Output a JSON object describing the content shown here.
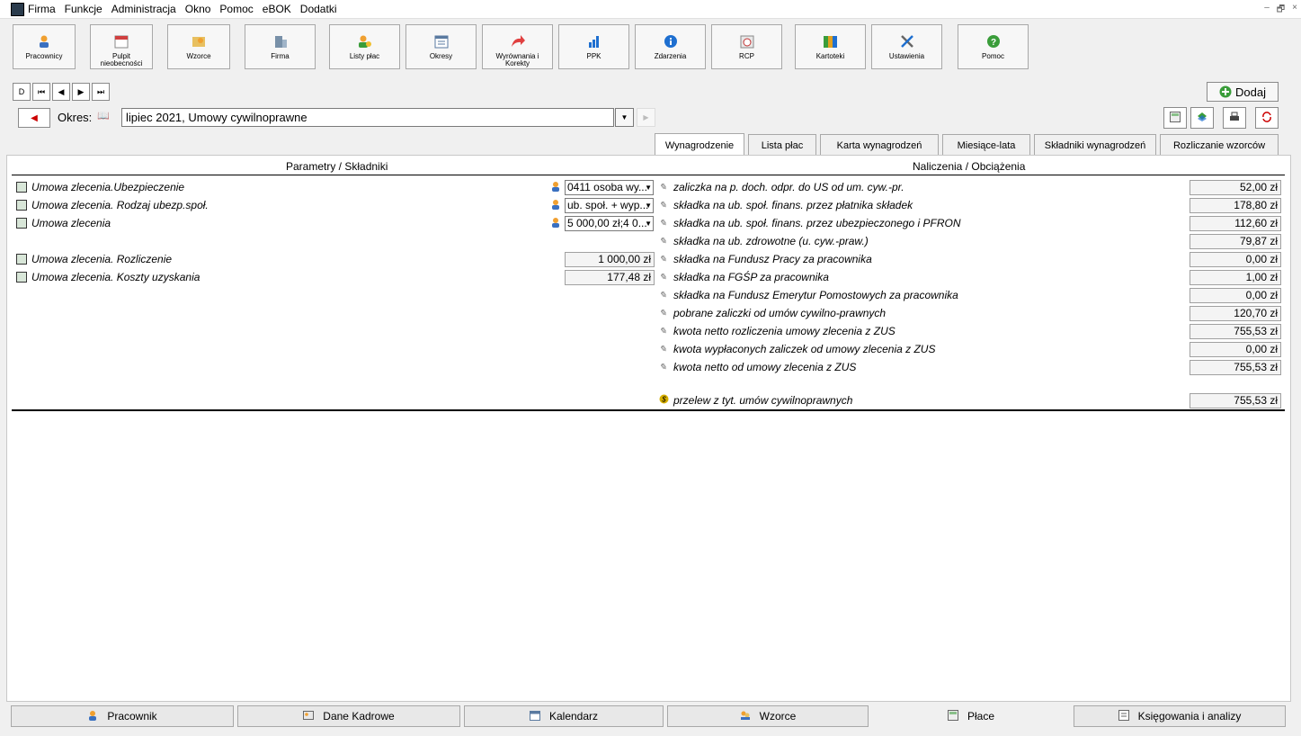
{
  "menu": [
    "Firma",
    "Funkcje",
    "Administracja",
    "Okno",
    "Pomoc",
    "eBOK",
    "Dodatki"
  ],
  "window_controls": [
    "–",
    "🗗",
    "×"
  ],
  "toolbar": [
    {
      "label": "Pracownicy",
      "icon": "person-icon"
    },
    {
      "label": "Pulpit nieobecności",
      "icon": "calendar-icon"
    },
    {
      "label": "Wzorce",
      "icon": "templates-icon"
    },
    {
      "label": "Firma",
      "icon": "building-icon"
    },
    {
      "label": "Listy płac",
      "icon": "payroll-icon"
    },
    {
      "label": "Okresy",
      "icon": "periods-icon"
    },
    {
      "label": "Wyrównania i Korekty",
      "icon": "correction-arrow-icon"
    },
    {
      "label": "PPK",
      "icon": "chart-bars-icon"
    },
    {
      "label": "Zdarzenia",
      "icon": "info-icon"
    },
    {
      "label": "RCP",
      "icon": "clock-icon"
    },
    {
      "label": "Kartoteki",
      "icon": "files-icon"
    },
    {
      "label": "Ustawienia",
      "icon": "tools-icon"
    },
    {
      "label": "Pomoc",
      "icon": "help-icon"
    }
  ],
  "nav": [
    "D",
    "⏮",
    "◀",
    "▶",
    "⏭"
  ],
  "dodaj_label": "Dodaj",
  "okres": {
    "label": "Okres:",
    "value": "lipiec 2021, Umowy cywilnoprawne"
  },
  "tabs": [
    "Wynagrodzenie",
    "Lista płac",
    "Karta wynagrodzeń",
    "Miesiące-lata",
    "Składniki wynagrodzeń",
    "Rozliczanie wzorców"
  ],
  "active_tab": "Wynagrodzenie",
  "headers": {
    "left": "Parametry / Składniki",
    "right": "Naliczenia / Obciążenia"
  },
  "params": [
    {
      "label": "Umowa zlecenia.Ubezpieczenie",
      "value": "0411 osoba wy..."
    },
    {
      "label": "Umowa zlecenia. Rodzaj ubezp.społ.",
      "value": "ub. społ. + wyp..."
    },
    {
      "label": "Umowa zlecenia",
      "value": "5 000,00 zł;4 0..."
    },
    {
      "label": "Umowa zlecenia. Rozliczenie",
      "value": "1 000,00 zł"
    },
    {
      "label": "Umowa zlecenia. Koszty uzyskania",
      "value": "177,48 zł"
    }
  ],
  "naliczenia": [
    {
      "label": "zaliczka na p. doch. odpr. do US od um. cyw.-pr.",
      "value": "52,00 zł"
    },
    {
      "label": "składka na ub. społ. finans. przez płatnika składek",
      "value": "178,80 zł"
    },
    {
      "label": "składka na ub. społ. finans. przez ubezpieczonego i PFRON",
      "value": "112,60 zł"
    },
    {
      "label": "składka na ub. zdrowotne (u. cyw.-praw.)",
      "value": "79,87 zł"
    },
    {
      "label": "składka na Fundusz Pracy za pracownika",
      "value": "0,00 zł"
    },
    {
      "label": "składka na FGŚP za pracownika",
      "value": "1,00 zł"
    },
    {
      "label": "składka na Fundusz Emerytur Pomostowych za pracownika",
      "value": "0,00 zł"
    },
    {
      "label": "pobrane zaliczki od umów cywilno-prawnych",
      "value": "120,70 zł"
    },
    {
      "label": "kwota netto rozliczenia umowy zlecenia z ZUS",
      "value": "755,53 zł"
    },
    {
      "label": "kwota wypłaconych zaliczek od umowy zlecenia z ZUS",
      "value": "0,00 zł"
    },
    {
      "label": "kwota netto od umowy zlecenia z ZUS",
      "value": "755,53 zł"
    }
  ],
  "przelew": {
    "label": "przelew z tyt. umów cywilnoprawnych",
    "value": "755,53 zł"
  },
  "bottom_tabs": [
    "Pracownik",
    "Dane Kadrowe",
    "Kalendarz",
    "Wzorce",
    "Płace",
    "Księgowania i analizy"
  ],
  "colors": {
    "accent_green": "#3a9d3a",
    "red": "#cc0000",
    "blue": "#1e6fd0"
  }
}
